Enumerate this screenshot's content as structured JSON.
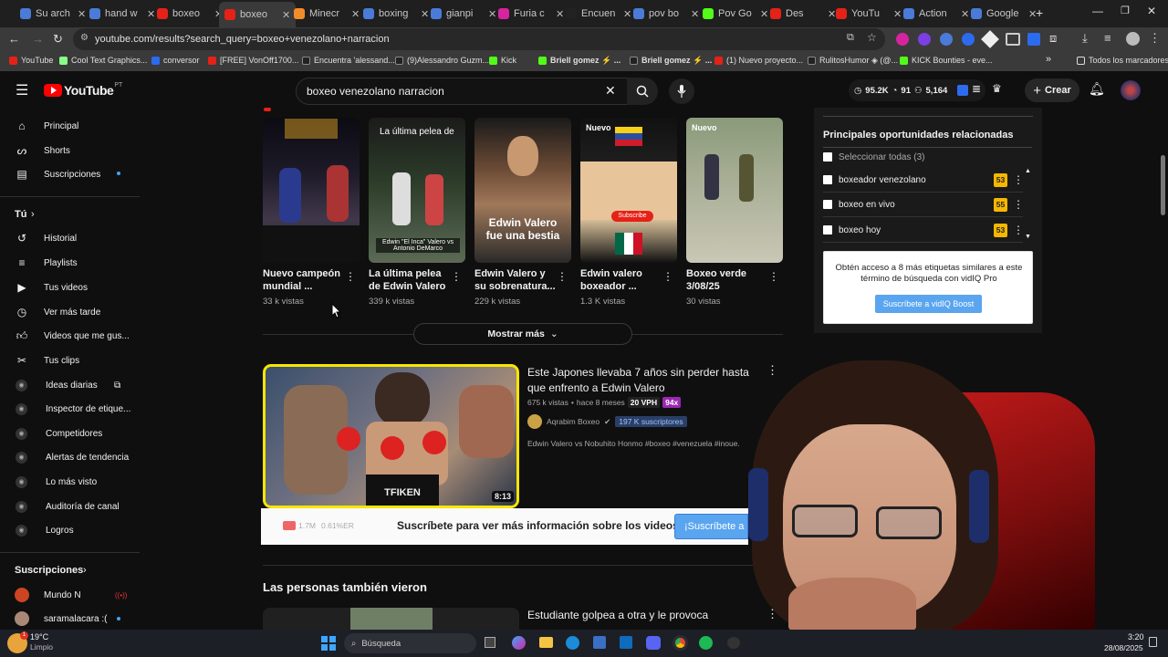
{
  "browser": {
    "tabs": [
      {
        "label": "Su arch",
        "color": "#4a7bd8"
      },
      {
        "label": "hand w",
        "color": "#4a7bd8"
      },
      {
        "label": "boxeo",
        "color": "#e62117"
      },
      {
        "label": "boxeo",
        "color": "#e62117"
      },
      {
        "label": "Minecr",
        "color": "#f28c28"
      },
      {
        "label": "boxing",
        "color": "#4a7bd8"
      },
      {
        "label": "gianpi",
        "color": "#4a7bd8"
      },
      {
        "label": "Furia c",
        "color": "#d6249f"
      },
      {
        "label": "Encuen",
        "color": "#222222"
      },
      {
        "label": "pov bo",
        "color": "#4a7bd8"
      },
      {
        "label": "Pov Go",
        "color": "#53fc18"
      },
      {
        "label": "Des",
        "color": "#e62117"
      },
      {
        "label": "YouTu",
        "color": "#e62117"
      },
      {
        "label": "Action",
        "color": "#4a7bd8"
      },
      {
        "label": "Google",
        "color": "#4a7bd8"
      }
    ],
    "url": "youtube.com/results?search_query=boxeo+venezolano+narracion",
    "bookmarks": [
      "YouTube",
      "Cool Text Graphics...",
      "conversor",
      "[FREE] VonOff1700...",
      "Encuentra 'alessand...",
      "(9)Alessandro Guzm...",
      "Kick",
      "Briell gomez ⚡ ...",
      "Briell gomez ⚡ ...",
      "(1) Nuevo proyecto...",
      "RulitosHumor ◈ (@...",
      "KICK Bounties - eve...",
      "Todos los marcadores"
    ]
  },
  "youtube": {
    "logo_text": "YouTube",
    "logo_region": "PT",
    "search_value": "boxeo venezolano narracion",
    "stats": {
      "views": "95.2K",
      "count": "91",
      "subs": "5,164"
    },
    "create_label": "Crear"
  },
  "sidebar": {
    "main": [
      "Principal",
      "Shorts",
      "Suscripciones"
    ],
    "you_header": "Tú",
    "you_items": [
      "Historial",
      "Playlists",
      "Tus videos",
      "Ver más tarde",
      "Videos que me gus...",
      "Tus clips"
    ],
    "vidiq_items": [
      "Ideas diarias",
      "Inspector de etique...",
      "Competidores",
      "Alertas de tendencia",
      "Lo más visto",
      "Auditoría de canal",
      "Logros"
    ],
    "subs_header": "Suscripciones",
    "subs": [
      "Mundo N",
      "saramalacara :("
    ]
  },
  "shorts": [
    {
      "title": "Nuevo campeón mundial ...",
      "views": "33 k vistas",
      "overlay": "",
      "badge": ""
    },
    {
      "title": "La última pelea de Edwin Valero",
      "views": "339 k vistas",
      "overlay": "La última pelea de",
      "badge": ""
    },
    {
      "title": "Edwin Valero y su sobrenatura...",
      "views": "229 k vistas",
      "overlay": "Edwin Valero fue una bestia",
      "badge": ""
    },
    {
      "title": "Edwin valero boxeador ...",
      "views": "1.3 K vistas",
      "overlay": "",
      "badge": "Nuevo"
    },
    {
      "title": "Boxeo verde 3/08/25",
      "views": "30 vistas",
      "overlay": "",
      "badge": "Nuevo"
    }
  ],
  "short_captions": {
    "valero_inca": "Edwin \"El Inca\" Valero vs Antonio DeMarco",
    "subscribe": "Subscribe"
  },
  "show_more": "Mostrar más",
  "video": {
    "title": "Este Japones llevaba 7 años sin perder hasta que enfrento a Edwin Valero",
    "views": "675 k vistas",
    "age": "hace 8 meses",
    "vph": "20 VPH",
    "multiplier": "94x",
    "channel": "Aqrabim Boxeo",
    "subs": "197 K suscriptores",
    "desc": "Edwin Valero vs Nobuhito Honmo #boxeo #venezuela #inoue.",
    "duration": "8:13",
    "trunks": "TFIKEN"
  },
  "vidiq_banner": {
    "views": "1.7M",
    "er": "0.61%ER",
    "text": "Suscríbete para ver más información sobre los videos",
    "button": "¡Suscríbete a"
  },
  "also_watched": {
    "header": "Las personas también vieron",
    "first_title": "Estudiante golpea a otra y le provoca"
  },
  "vidiq_panel": {
    "title": "Principales oportunidades relacionadas",
    "select_all": "Seleccionar todas (3)",
    "tags": [
      {
        "label": "boxeador venezolano",
        "score": "53"
      },
      {
        "label": "boxeo en vivo",
        "score": "55"
      },
      {
        "label": "boxeo hoy",
        "score": "53"
      }
    ],
    "promo_text": "Obtén acceso a 8 más etiquetas similares a este término de búsqueda con vidIQ Pro",
    "promo_button": "Suscríbete a vidIQ Boost"
  },
  "taskbar": {
    "temp": "19°C",
    "weather": "Limpio",
    "search": "Búsqueda",
    "time": "3:20",
    "date": "28/08/2025"
  }
}
